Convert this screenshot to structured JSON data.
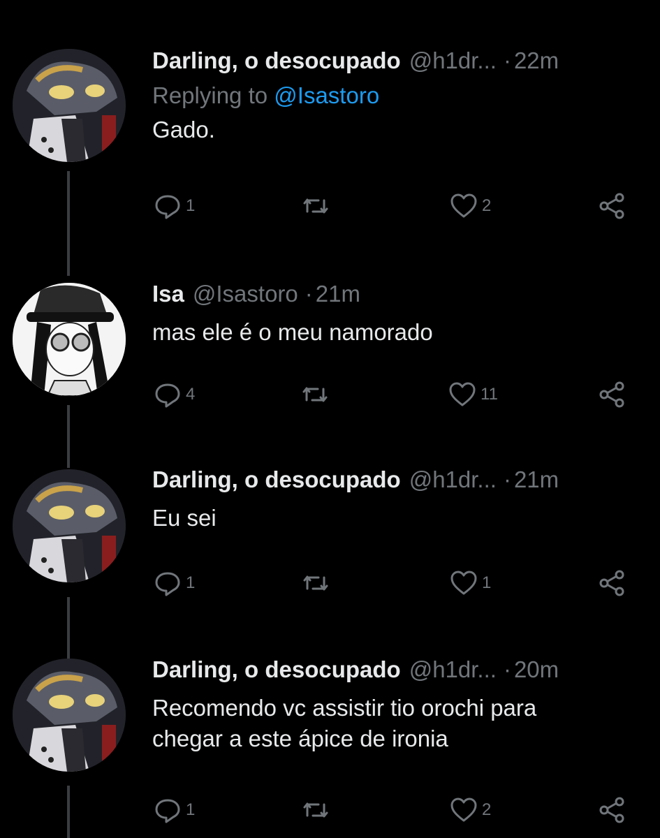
{
  "colors": {
    "background": "#000000",
    "text": "#e7e9ea",
    "secondary": "#71767b",
    "mention": "#1d9bf0"
  },
  "tweets": [
    {
      "name": "Darling, o desocupado",
      "handle": "@h1dr...",
      "dot": "·",
      "time": "22m",
      "replying_label": "Replying to",
      "replying_mention": "@Isastoro",
      "text": [
        "Gado."
      ],
      "reply_count": "1",
      "like_count": "2",
      "avatar": "gray-wolf-character"
    },
    {
      "name": "Isa",
      "handle": "@Isastoro",
      "dot": "·",
      "time": "21m",
      "text": [
        "mas ele é o meu namorado"
      ],
      "reply_count": "4",
      "like_count": "11",
      "avatar": "sunglasses-hat-character"
    },
    {
      "name": "Darling, o desocupado",
      "handle": "@h1dr...",
      "dot": "·",
      "time": "21m",
      "text": [
        "Eu sei"
      ],
      "reply_count": "1",
      "like_count": "1",
      "avatar": "gray-wolf-character"
    },
    {
      "name": "Darling, o desocupado",
      "handle": "@h1dr...",
      "dot": "·",
      "time": "20m",
      "text": [
        "Recomendo vc assistir tio orochi para",
        "chegar a este ápice de ironia"
      ],
      "reply_count": "1",
      "like_count": "2",
      "avatar": "gray-wolf-character"
    }
  ],
  "icons": [
    "reply-icon",
    "retweet-icon",
    "like-icon",
    "share-icon"
  ]
}
